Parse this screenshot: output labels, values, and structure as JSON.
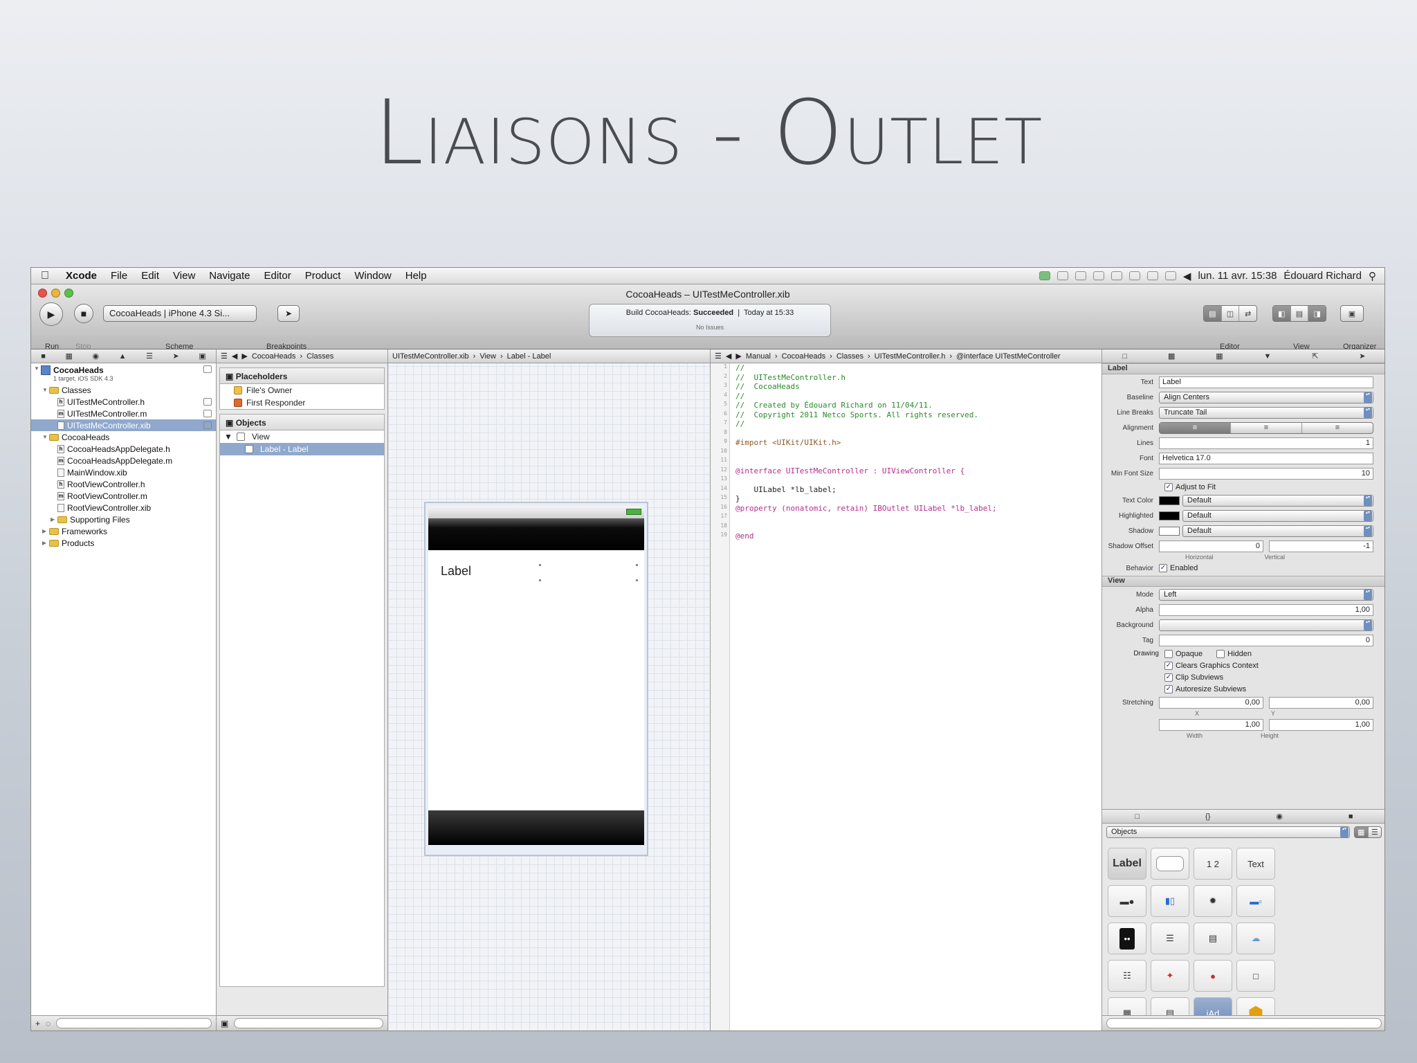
{
  "slide": {
    "title": "Liaisons - Outlet"
  },
  "menubar": {
    "app": "Xcode",
    "items": [
      "File",
      "Edit",
      "View",
      "Navigate",
      "Editor",
      "Product",
      "Window",
      "Help"
    ],
    "datetime": "lun. 11 avr.  15:38",
    "user": "Édouard Richard"
  },
  "window": {
    "title": "CocoaHeads – UITestMeController.xib",
    "scheme": "CocoaHeads | iPhone 4.3 Si...",
    "labels": {
      "run": "Run",
      "stop": "Stop",
      "scheme": "Scheme",
      "breakpoints": "Breakpoints",
      "editor": "Editor",
      "view": "View",
      "organizer": "Organizer"
    },
    "activity": {
      "prefix": "Build CocoaHeads:",
      "status": "Succeeded",
      "time": "Today at 15:33",
      "issues": "No Issues"
    }
  },
  "navigator": {
    "project": "CocoaHeads",
    "project_sub": "1 target, iOS SDK 4.3",
    "rows": [
      {
        "label": "Classes",
        "kind": "folder",
        "indent": 1
      },
      {
        "label": "UITestMeController.h",
        "kind": "h",
        "indent": 2
      },
      {
        "label": "UITestMeController.m",
        "kind": "m",
        "indent": 2
      },
      {
        "label": "UITestMeController.xib",
        "kind": "xib",
        "indent": 2,
        "selected": true
      },
      {
        "label": "CocoaHeads",
        "kind": "folder",
        "indent": 1
      },
      {
        "label": "CocoaHeadsAppDelegate.h",
        "kind": "h",
        "indent": 2
      },
      {
        "label": "CocoaHeadsAppDelegate.m",
        "kind": "m",
        "indent": 2
      },
      {
        "label": "MainWindow.xib",
        "kind": "xib",
        "indent": 2
      },
      {
        "label": "RootViewController.h",
        "kind": "h",
        "indent": 2
      },
      {
        "label": "RootViewController.m",
        "kind": "m",
        "indent": 2
      },
      {
        "label": "RootViewController.xib",
        "kind": "xib",
        "indent": 2
      },
      {
        "label": "Supporting Files",
        "kind": "folder",
        "indent": 2
      },
      {
        "label": "Frameworks",
        "kind": "folder",
        "indent": 1
      },
      {
        "label": "Products",
        "kind": "folder",
        "indent": 1
      }
    ]
  },
  "jumpbar_ib": [
    "CocoaHeads",
    "Classes",
    "UITestMeController.xib",
    "View",
    "Label - Label"
  ],
  "jumpbar_code": [
    "Manual",
    "CocoaHeads",
    "Classes",
    "UITestMeController.h",
    "@interface UITestMeController"
  ],
  "outline": {
    "placeholders": "Placeholders",
    "files_owner": "File's Owner",
    "first_responder": "First Responder",
    "objects": "Objects",
    "view": "View",
    "label_item": "Label - Label"
  },
  "canvas": {
    "label_text": "Label"
  },
  "code": {
    "lines": [
      "//",
      "//  UITestMeController.h",
      "//  CocoaHeads",
      "//",
      "//  Created by Édouard Richard on 11/04/11.",
      "//  Copyright 2011 Netco Sports. All rights reserved.",
      "//",
      "",
      "#import <UIKit/UIKit.h>",
      "",
      "",
      "@interface UITestMeController : UIViewController {",
      "",
      "    UILabel *lb_label;",
      "}",
      "@property (nonatomic, retain) IBOutlet UILabel *lb_label;",
      "",
      "",
      "@end"
    ]
  },
  "inspector": {
    "section_label": "Label",
    "text_label": "Text",
    "text_value": "Label",
    "baseline_label": "Baseline",
    "baseline_value": "Align Centers",
    "linebreaks_label": "Line Breaks",
    "linebreaks_value": "Truncate Tail",
    "alignment_label": "Alignment",
    "lines_label": "Lines",
    "lines_value": "1",
    "font_label": "Font",
    "font_value": "Helvetica 17.0",
    "minfont_label": "Min Font Size",
    "minfont_value": "10",
    "adjust_label": "Adjust to Fit",
    "textcolor_label": "Text Color",
    "textcolor_value": "Default",
    "highlighted_label": "Highlighted",
    "highlighted_value": "Default",
    "shadow_label": "Shadow",
    "shadow_value": "Default",
    "shadowoffset_label": "Shadow Offset",
    "shadow_h": "0",
    "shadow_v": "-1",
    "horizontal": "Horizontal",
    "vertical": "Vertical",
    "behavior_label": "Behavior",
    "enabled_label": "Enabled",
    "section_view": "View",
    "mode_label": "Mode",
    "mode_value": "Left",
    "alpha_label": "Alpha",
    "alpha_value": "1,00",
    "background_label": "Background",
    "tag_label": "Tag",
    "tag_value": "0",
    "drawing_label": "Drawing",
    "opaque_label": "Opaque",
    "hidden_label": "Hidden",
    "clears_label": "Clears Graphics Context",
    "clip_label": "Clip Subviews",
    "autoresize_label": "Autoresize Subviews",
    "stretching_label": "Stretching",
    "st_x": "0,00",
    "st_y": "0,00",
    "st_w": "1,00",
    "st_h": "1,00",
    "x_label": "X",
    "y_label": "Y",
    "width_label": "Width",
    "height_label": "Height"
  },
  "library": {
    "filter": "Objects",
    "tiles": {
      "label": "Label",
      "segments": "1  2",
      "textfield": "Text",
      "iad": "iAd"
    }
  }
}
